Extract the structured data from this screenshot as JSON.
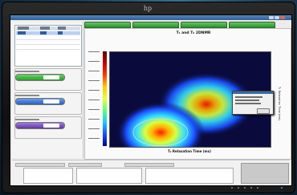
{
  "device": {
    "brand_mark": "hp"
  },
  "app": {
    "window_title": ""
  },
  "plot": {
    "title": "T₁ and T₂ 2DNMR",
    "subtitle": "",
    "x_axis_label": "T₂ Relaxation Time (ms)",
    "y_axis_label": "T₁ Relaxation Time (ms)"
  },
  "colors": {
    "green_control": "#2d9a2d",
    "blue_control": "#2e5fb5",
    "purple_control": "#5c3a9e",
    "tab_green": "#2f8f2f",
    "heatmap_background": "#0a0a3c"
  },
  "dialog": {
    "ok_label": "OK"
  },
  "icons": [
    "hp-logo-icon",
    "minimize-icon",
    "maximize-icon",
    "close-icon"
  ]
}
